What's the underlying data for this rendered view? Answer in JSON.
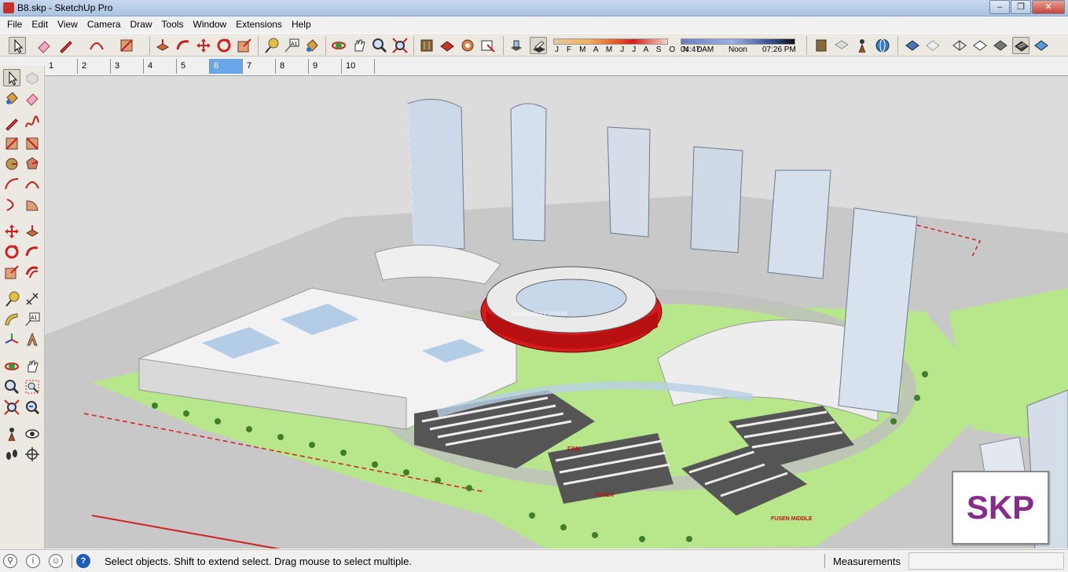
{
  "window": {
    "title": "B8.skp - SketchUp Pro",
    "minimize": "‒",
    "restore": "❐",
    "close": "✕"
  },
  "menu": [
    "File",
    "Edit",
    "View",
    "Camera",
    "Draw",
    "Tools",
    "Window",
    "Extensions",
    "Help"
  ],
  "toolbar": {
    "icons": [
      "select-icon",
      "eraser-icon",
      "pencil-icon",
      "arc-icon",
      "rectangle-icon",
      "push-pull-icon",
      "follow-me-icon",
      "move-icon",
      "rotate-icon",
      "scale-icon",
      "tape-measure-icon",
      "text-icon",
      "paint-bucket-icon",
      "orbit-icon",
      "pan-icon",
      "zoom-icon",
      "zoom-extents-icon",
      "warehouse-icon",
      "extension-warehouse-icon",
      "layout-icon",
      "style-builder-icon",
      "shadows-icon",
      "display-shadows-icon"
    ],
    "shadow": {
      "months": "J F M A M J J A S O N D",
      "sunrise": "04:47 AM",
      "noon": "Noon",
      "sunset": "07:26 PM"
    }
  },
  "scenes": [
    "1",
    "2",
    "3",
    "4",
    "5",
    "6",
    "7",
    "8",
    "9",
    "10"
  ],
  "active_scene": "6",
  "left_toolbar": [
    "select-icon",
    "component-icon",
    "paint-bucket-icon",
    "eraser-icon",
    "line-icon",
    "freehand-icon",
    "rectangle-icon",
    "rotated-rectangle-icon",
    "circle-icon",
    "polygon-icon",
    "arc-icon",
    "two-point-arc-icon",
    "three-point-arc-icon",
    "pie-icon",
    "move-icon",
    "push-pull-icon",
    "rotate-icon",
    "follow-me-icon",
    "scale-icon",
    "offset-icon",
    "tape-measure-icon",
    "dimension-icon",
    "protractor-icon",
    "text-icon",
    "axes-icon",
    "3d-text-icon",
    "orbit-icon",
    "pan-icon",
    "zoom-icon",
    "zoom-window-icon",
    "zoom-extents-icon",
    "previous-view-icon",
    "position-camera-icon",
    "look-around-icon",
    "walk-icon",
    "section-plane-icon"
  ],
  "viewport": {
    "badge": "SKP",
    "building_signs": [
      "FUSEN MIDDLE CENTER",
      "FSN",
      "FUSEN",
      "FUSEN MIDDLE"
    ]
  },
  "status": {
    "message": "Select objects. Shift to extend select. Drag mouse to select multiple.",
    "measurements_label": "Measurements",
    "measurements_value": ""
  },
  "colors": {
    "accent": "#6aa7e8",
    "stadium_red": "#d41a1a",
    "grass": "#b8e68a",
    "ground": "#c9c9c9"
  }
}
